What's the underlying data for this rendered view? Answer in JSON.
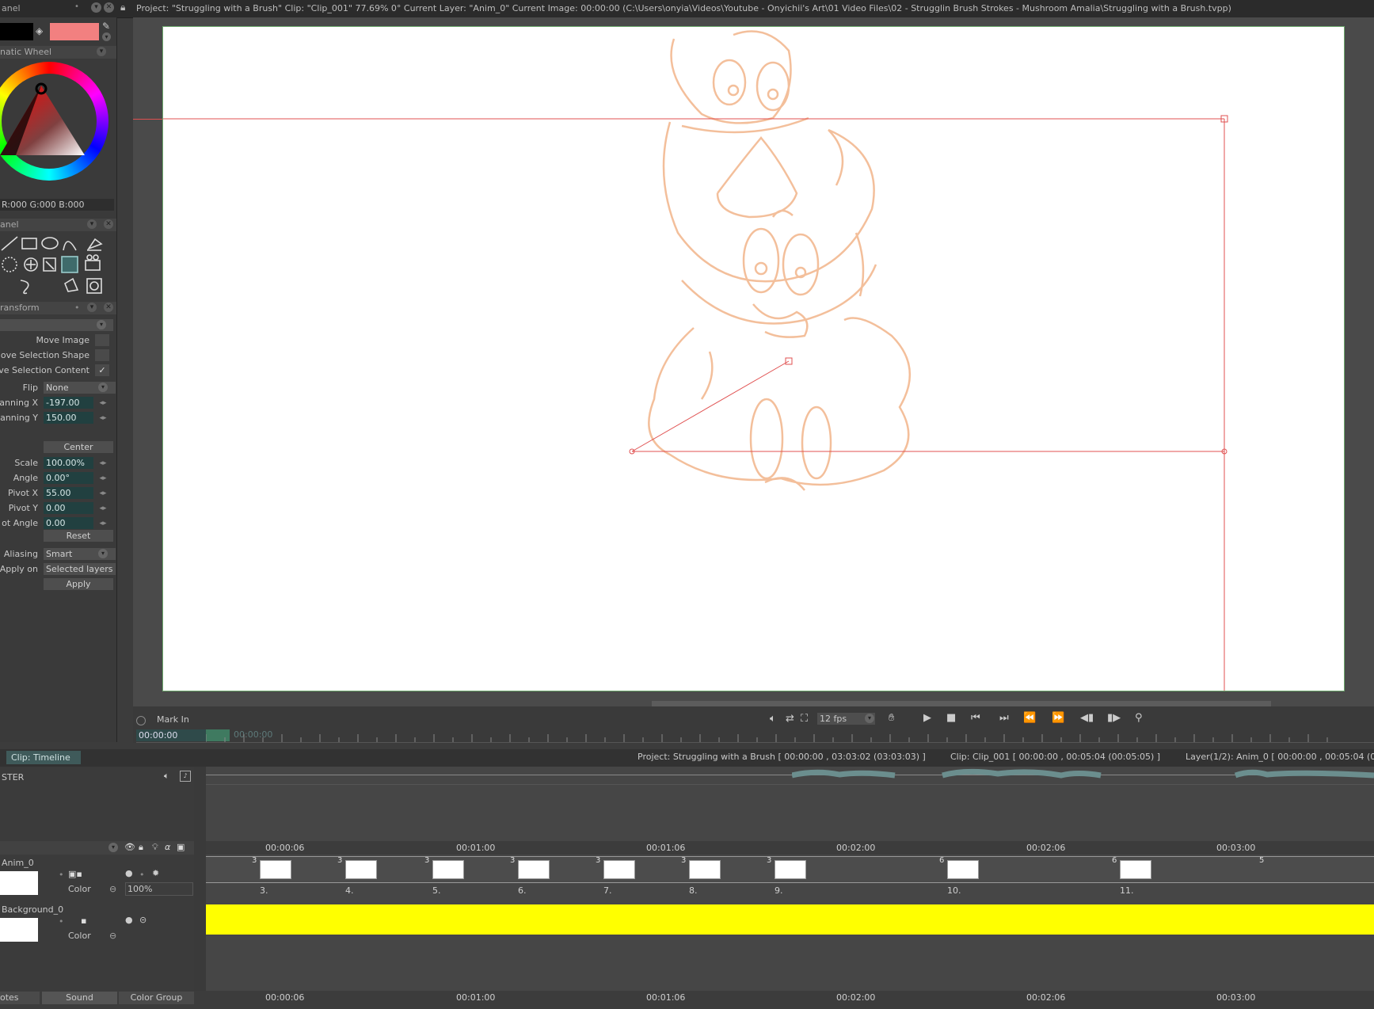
{
  "title_bar": {
    "text": "Project: \"Struggling with a Brush\"  Clip: \"Clip_001\"   77.69%   0°  Current Layer: \"Anim_0\"  Current Image: 00:00:00 (C:\\Users\\onyia\\Videos\\Youtube - Onyichii's Art\\01 Video Files\\02 - Strugglin Brush Strokes - Mushroom Amalia\\Struggling with a Brush.tvpp)",
    "panel_label": "anel"
  },
  "colors": {
    "primary": "#000000",
    "secondary": "#f28080",
    "canvas_border": "#6ca86c",
    "guide": "#e05050",
    "sketch": "#f2b48a",
    "yellow_track": "#ffff00"
  },
  "color_panel": {
    "header": "natic Wheel",
    "rgb_readout": "R:000 G:000 B:000"
  },
  "tool_panel": {
    "header": "anel"
  },
  "transform_panel": {
    "header": "ransform",
    "move_image": "Move Image",
    "move_selection_shape": "ove Selection Shape",
    "move_selection_content": "ve Selection Content",
    "flip_label": "Flip",
    "flip_value": "None",
    "panning_x_label": "anning X",
    "panning_x_value": "-197.00",
    "panning_y_label": "anning Y",
    "panning_y_value": "150.00",
    "center_button": "Center",
    "scale_label": "Scale",
    "scale_value": "100.00%",
    "angle_label": "Angle",
    "angle_value": "0.00°",
    "pivot_x_label": "Pivot X",
    "pivot_x_value": "55.00",
    "pivot_y_label": "Pivot Y",
    "pivot_y_value": "0.00",
    "pivot_angle_label": "ot Angle",
    "pivot_angle_value": "0.00",
    "reset_button": "Reset",
    "aliasing_label": "Aliasing",
    "aliasing_value": "Smart",
    "apply_on_label": "Apply on",
    "apply_on_value": "Selected layers",
    "apply_button": "Apply"
  },
  "transport": {
    "mark_in": "Mark In",
    "time_current": "00:00:00",
    "time_out": "00:00:00",
    "fps": "12 fps"
  },
  "timeline": {
    "tab_label": "Clip: Timeline",
    "project_info": "Project: Struggling with a Brush [ 00:00:00 , 03:03:02  (03:03:03) ]",
    "clip_info": "Clip: Clip_001 [ 00:00:00 , 00:05:04  (00:05:05) ]",
    "layer_info": "Layer(1/2): Anim_0 [ 00:00:00 , 00:05:04  (00",
    "master_label": "STER",
    "ruler_marks": [
      "00:00:06",
      "00:01:00",
      "00:01:06",
      "00:02:00",
      "00:02:06",
      "00:03:00"
    ],
    "layers": [
      {
        "name": "Anim_0",
        "color_label": "Color",
        "opacity": "100%"
      },
      {
        "name": "Background_0",
        "color_label": "Color"
      }
    ],
    "frames": [
      {
        "num": "3.",
        "dur": "3"
      },
      {
        "num": "4.",
        "dur": "3"
      },
      {
        "num": "5.",
        "dur": "3"
      },
      {
        "num": "6.",
        "dur": "3"
      },
      {
        "num": "7.",
        "dur": "3"
      },
      {
        "num": "8.",
        "dur": "3"
      },
      {
        "num": "9.",
        "dur": "3"
      },
      {
        "num": "10.",
        "dur": "6"
      },
      {
        "num": "11.",
        "dur": "6"
      },
      {
        "num": "",
        "dur": "5"
      }
    ],
    "bottom_tabs": {
      "notes": "otes",
      "sound": "Sound",
      "color_group": "Color Group"
    },
    "bottom_ruler_marks": [
      "00:00:06",
      "00:01:00",
      "00:01:06",
      "00:02:00",
      "00:02:06",
      "00:03:00"
    ]
  }
}
